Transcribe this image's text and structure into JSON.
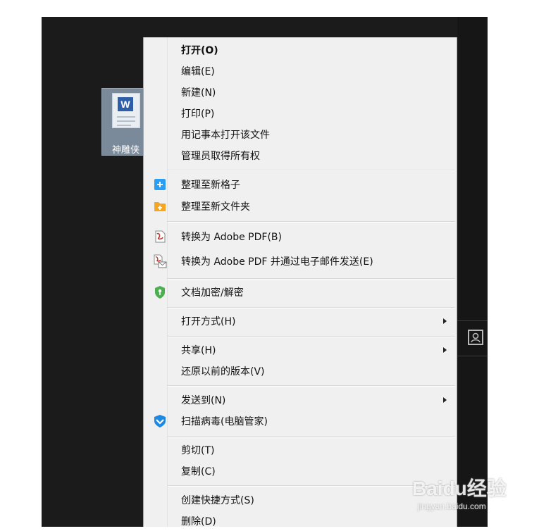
{
  "desktop": {
    "file": {
      "name": "神雕侠",
      "icon": "word-document-icon"
    },
    "side_icon": "person-card-icon"
  },
  "context_menu": {
    "items": [
      {
        "label": "打开(O)",
        "bold": true
      },
      {
        "label": "编辑(E)"
      },
      {
        "label": "新建(N)"
      },
      {
        "label": "打印(P)"
      },
      {
        "label": "用记事本打开该文件"
      },
      {
        "label": "管理员取得所有权"
      },
      {
        "label": "整理至新格子",
        "icon": "new-grid-icon"
      },
      {
        "label": "整理至新文件夹",
        "icon": "new-folder-icon"
      },
      {
        "label": "转换为 Adobe PDF(B)",
        "icon": "adobe-pdf-icon"
      },
      {
        "label": "转换为 Adobe PDF 并通过电子邮件发送(E)",
        "icon": "adobe-pdf-email-icon"
      },
      {
        "label": "文档加密/解密",
        "icon": "shield-encrypt-icon"
      },
      {
        "label": "打开方式(H)",
        "submenu": true
      },
      {
        "label": "共享(H)",
        "submenu": true
      },
      {
        "label": "还原以前的版本(V)"
      },
      {
        "label": "发送到(N)",
        "submenu": true
      },
      {
        "label": "扫描病毒(电脑管家)",
        "icon": "pc-manager-shield-icon"
      },
      {
        "label": "剪切(T)"
      },
      {
        "label": "复制(C)"
      },
      {
        "label": "创建快捷方式(S)"
      },
      {
        "label": "删除(D)"
      }
    ]
  },
  "watermark": {
    "logo": "Baidu经验",
    "url": "jingyan.baidu.com"
  },
  "colors": {
    "desktop_bg": "#1b1b1b",
    "menu_bg": "#f0f0f0",
    "pdf_red": "#c0392b",
    "grid_blue": "#2a9df4",
    "folder_orange": "#f5a623",
    "shield_green": "#4caf50",
    "pc_manager_blue": "#1e88e5"
  }
}
